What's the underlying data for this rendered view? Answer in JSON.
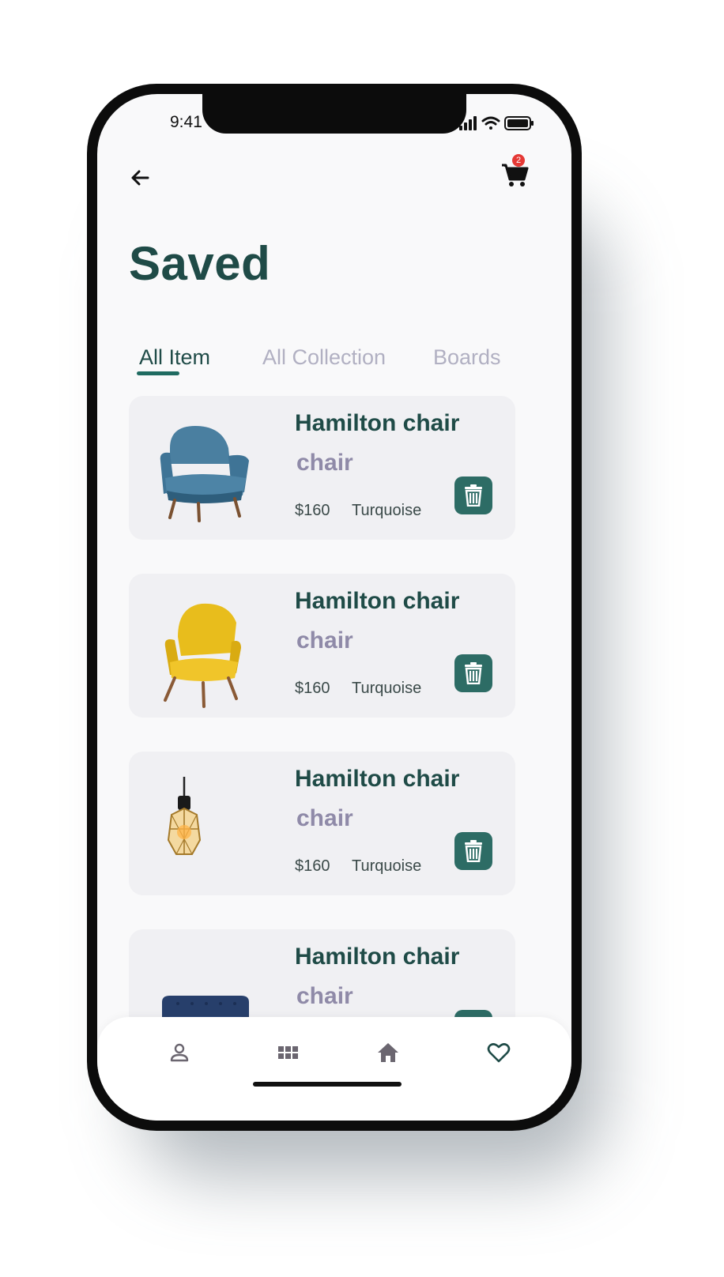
{
  "status_bar": {
    "time": "9:41"
  },
  "header": {
    "cart_badge": "2"
  },
  "page": {
    "title": "Saved"
  },
  "tabs": [
    {
      "label": "All Item",
      "active": true
    },
    {
      "label": "All Collection",
      "active": false
    },
    {
      "label": "Boards",
      "active": false
    }
  ],
  "items": [
    {
      "name": "Hamilton chair",
      "category": "chair",
      "price": "$160",
      "color": "Turquoise",
      "image": "blue-armchair"
    },
    {
      "name": "Hamilton chair",
      "category": "chair",
      "price": "$160",
      "color": "Turquoise",
      "image": "yellow-armchair"
    },
    {
      "name": "Hamilton chair",
      "category": "chair",
      "price": "$160",
      "color": "Turquoise",
      "image": "pendant-lamp"
    },
    {
      "name": "Hamilton chair",
      "category": "chair",
      "price": "",
      "color": "",
      "image": "navy-sofa"
    }
  ],
  "bottom_nav": [
    "profile-icon",
    "grid-icon",
    "home-icon",
    "heart-icon"
  ],
  "colors": {
    "primary": "#1f4b47",
    "accent": "#2d6c65",
    "muted": "#8f8aa8",
    "badge": "#e53935"
  }
}
